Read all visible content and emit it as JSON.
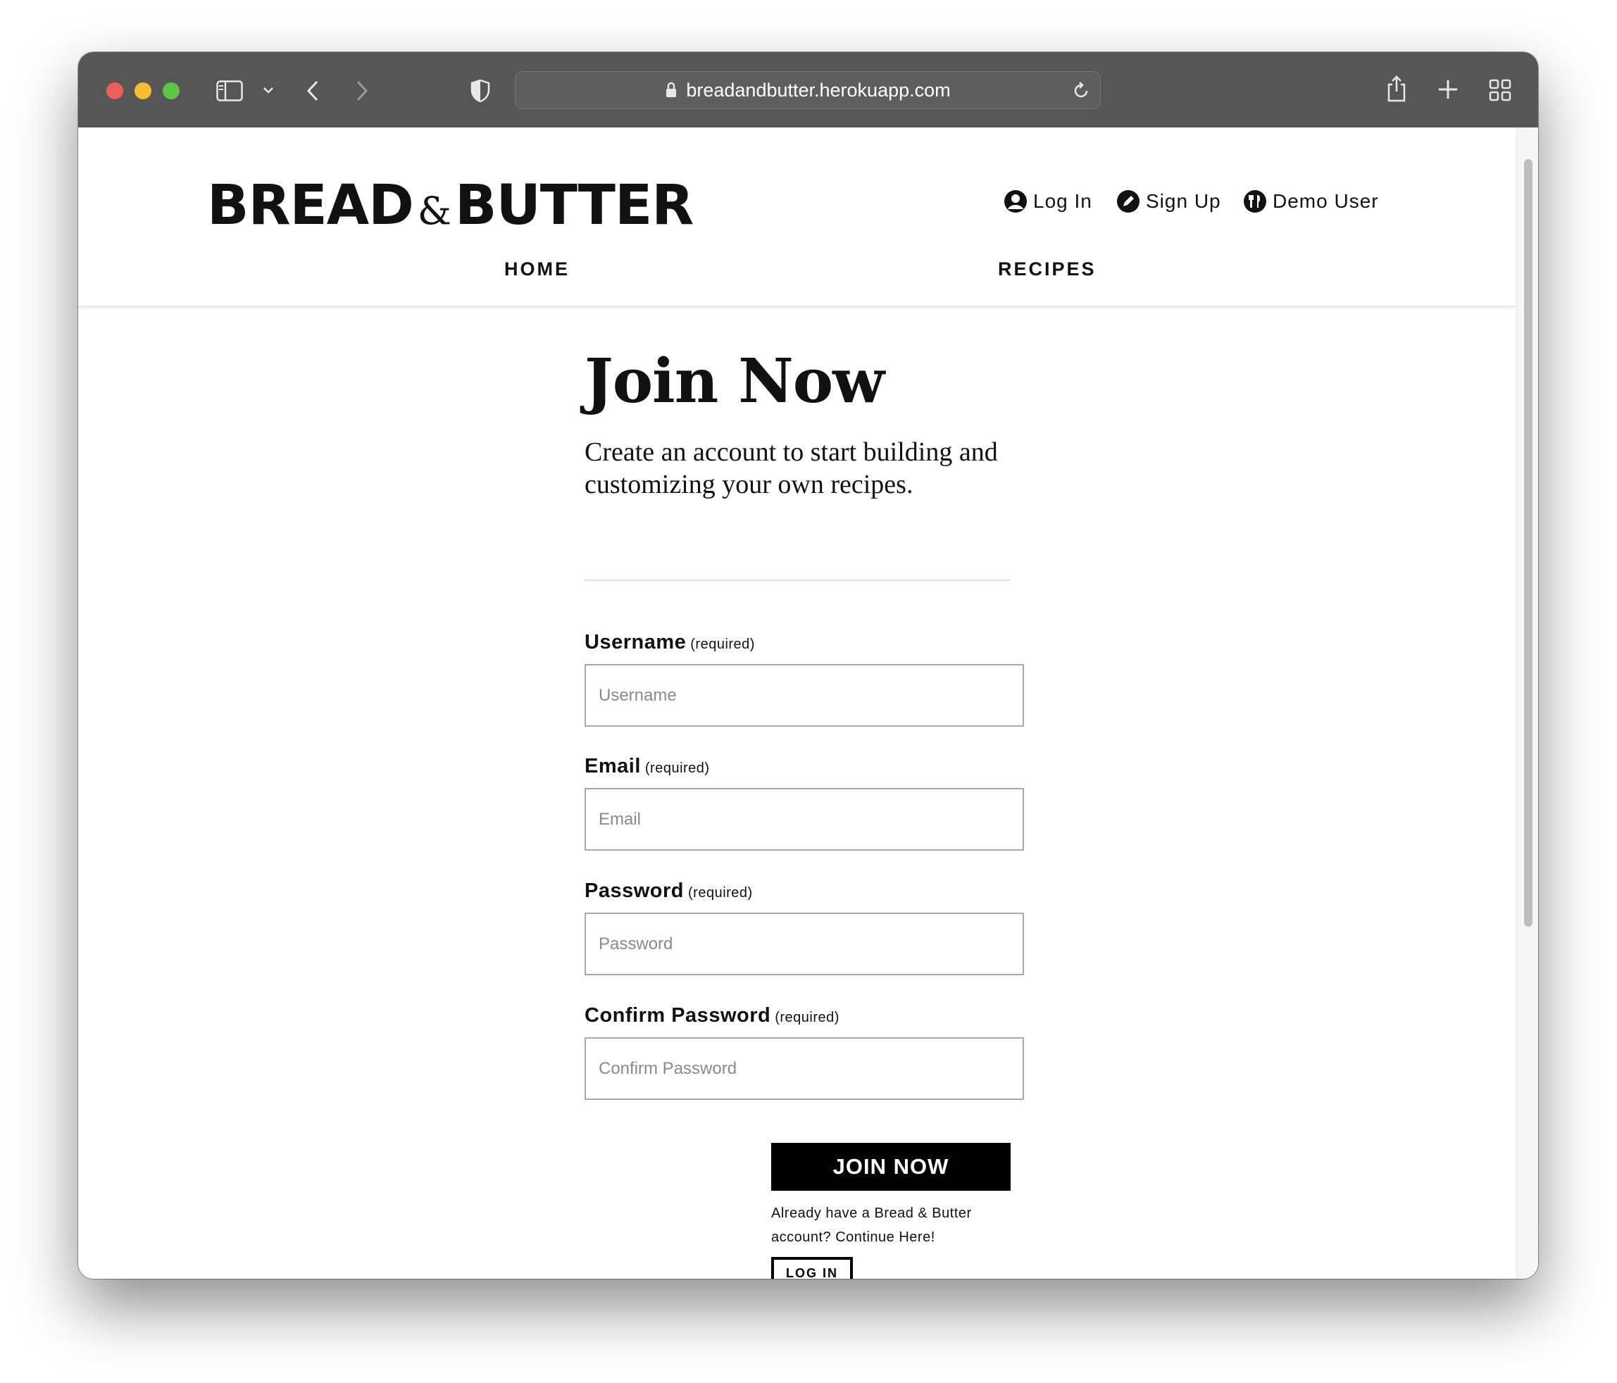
{
  "browser": {
    "url": "breadandbutter.herokuapp.com"
  },
  "site": {
    "logo_left": "BREAD",
    "logo_amp": "&",
    "logo_right": "BUTTER",
    "user_nav": {
      "login": "Log In",
      "signup": "Sign Up",
      "demo": "Demo User"
    },
    "main_nav": {
      "home": "HOME",
      "recipes": "RECIPES"
    }
  },
  "form": {
    "title": "Join Now",
    "subtitle": "Create an account to start building and customizing your own recipes.",
    "required_note": "(required)",
    "fields": {
      "username": {
        "label": "Username",
        "placeholder": "Username"
      },
      "email": {
        "label": "Email",
        "placeholder": "Email"
      },
      "password": {
        "label": "Password",
        "placeholder": "Password"
      },
      "confirm": {
        "label": "Confirm Password",
        "placeholder": "Confirm Password"
      }
    },
    "submit_label": "JOIN NOW",
    "already_text": "Already have a Bread & Butter account? Continue Here!",
    "login_label": "LOG IN"
  }
}
